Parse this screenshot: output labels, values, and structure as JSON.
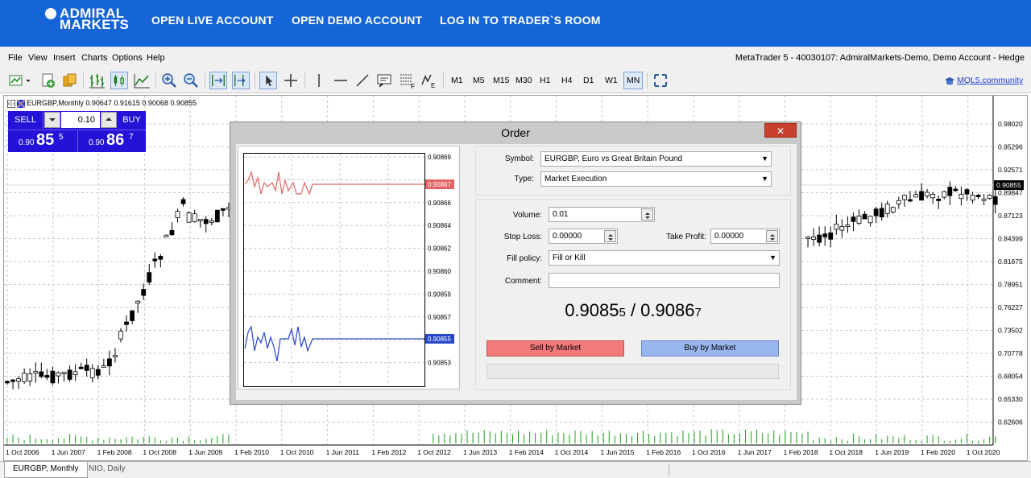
{
  "header": {
    "logo_line1": "ADMIRAL",
    "logo_line2": "MARKETS",
    "nav": [
      "OPEN LIVE ACCOUNT",
      "OPEN DEMO ACCOUNT",
      "LOG IN TO TRADER`S ROOM"
    ]
  },
  "menu": {
    "items": [
      "File",
      "View",
      "Insert",
      "Charts",
      "Options",
      "Help"
    ],
    "account": "MetaTrader 5 - 40030107: AdmiralMarkets-Demo, Demo Account - Hedge"
  },
  "toolbar": {
    "timeframes": [
      "M1",
      "M5",
      "M15",
      "M30",
      "H1",
      "H4",
      "D1",
      "W1",
      "MN"
    ],
    "active_timeframe": "MN",
    "community": "MQL5.community"
  },
  "chart": {
    "info": "EURGBP,Monthly  0.90647 0.91615 0.90068 0.90855",
    "price_label": "0.90855",
    "price_axis": [
      "0.98020",
      "0.95296",
      "0.92571",
      "0.89847",
      "0.87123",
      "0.84399",
      "0.81675",
      "0.78951",
      "0.76227",
      "0.73502",
      "0.70778",
      "0.68054",
      "0.65330",
      "0.62606"
    ],
    "time_axis": [
      "1 Oct 2006",
      "1 Jun 2007",
      "1 Feb 2008",
      "1 Oct 2008",
      "1 Jun 2009",
      "1 Feb 2010",
      "1 Oct 2010",
      "1 Jun 2011",
      "1 Feb 2012",
      "1 Oct 2012",
      "1 Jun 2013",
      "1 Feb 2014",
      "1 Oct 2014",
      "1 Jun 2015",
      "1 Feb 2016",
      "1 Oct 2016",
      "1 Jun 2017",
      "1 Feb 2018",
      "1 Oct 2018",
      "1 Jun 2019",
      "1 Feb 2020",
      "1 Oct 2020"
    ]
  },
  "trade_panel": {
    "sell": "SELL",
    "buy": "BUY",
    "volume": "0.10",
    "bid_prefix": "0.90",
    "bid_big": "85",
    "bid_sup": "5",
    "ask_prefix": "0.90",
    "ask_big": "86",
    "ask_sup": "7"
  },
  "tabs": [
    "EURGBP, Monthly",
    "NIO, Daily"
  ],
  "order": {
    "title": "Order",
    "close": "✕",
    "tick_axis": [
      "0.90869",
      "0.90867",
      "0.90866",
      "0.90864",
      "0.90862",
      "0.90860",
      "0.90859",
      "0.90857",
      "0.90855",
      "0.90853"
    ],
    "ask_label": "0.90867",
    "bid_label": "0.90855",
    "symbol_label": "Symbol:",
    "symbol_value": "EURGBP, Euro vs Great Britain Pound",
    "type_label": "Type:",
    "type_value": "Market Execution",
    "volume_label": "Volume:",
    "volume_value": "0.01",
    "sl_label": "Stop Loss:",
    "sl_value": "0.00000",
    "tp_label": "Take Profit:",
    "tp_value": "0.00000",
    "fill_label": "Fill policy:",
    "fill_value": "Fill or Kill",
    "comment_label": "Comment:",
    "comment_value": "",
    "price_bid_main": "0.9085",
    "price_bid_small": "5",
    "price_sep": " / ",
    "price_ask_main": "0.9086",
    "price_ask_small": "7",
    "sell_button": "Sell by Market",
    "buy_button": "Buy by Market",
    "colors": {
      "sell": "#f07676",
      "buy": "#9ab4ee",
      "ask_line": "#e46464",
      "bid_line": "#2848c8"
    }
  }
}
